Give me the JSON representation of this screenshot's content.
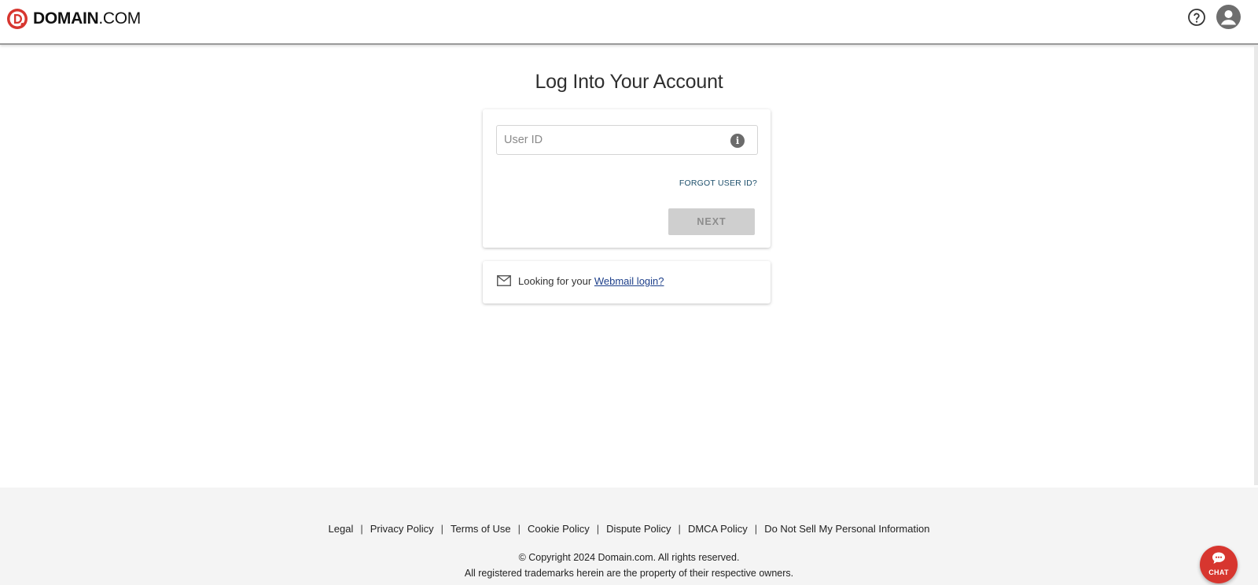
{
  "header": {
    "logo_bold": "DOMAIN",
    "logo_rest": ".COM",
    "help_icon": "help-circle-icon",
    "account_icon": "account-circle-icon",
    "brand_color": "#d7362f"
  },
  "main": {
    "title": "Log Into Your Account",
    "user_field": {
      "placeholder": "User ID",
      "value": ""
    },
    "forgot_label": "FORGOT USER ID?",
    "next_label": "NEXT",
    "webmail": {
      "prefix": "Looking for your",
      "link_label": "Webmail login?"
    }
  },
  "footer": {
    "links": [
      "Legal",
      "Privacy Policy",
      "Terms of Use",
      "Cookie Policy",
      "Dispute Policy",
      "DMCA Policy",
      "Do Not Sell My Personal Information"
    ],
    "separator": "|",
    "copyright": "© Copyright 2024 Domain.com. All rights reserved.",
    "trademarks": "All registered trademarks herein are the property of their respective owners."
  },
  "chat": {
    "label": "CHAT"
  }
}
